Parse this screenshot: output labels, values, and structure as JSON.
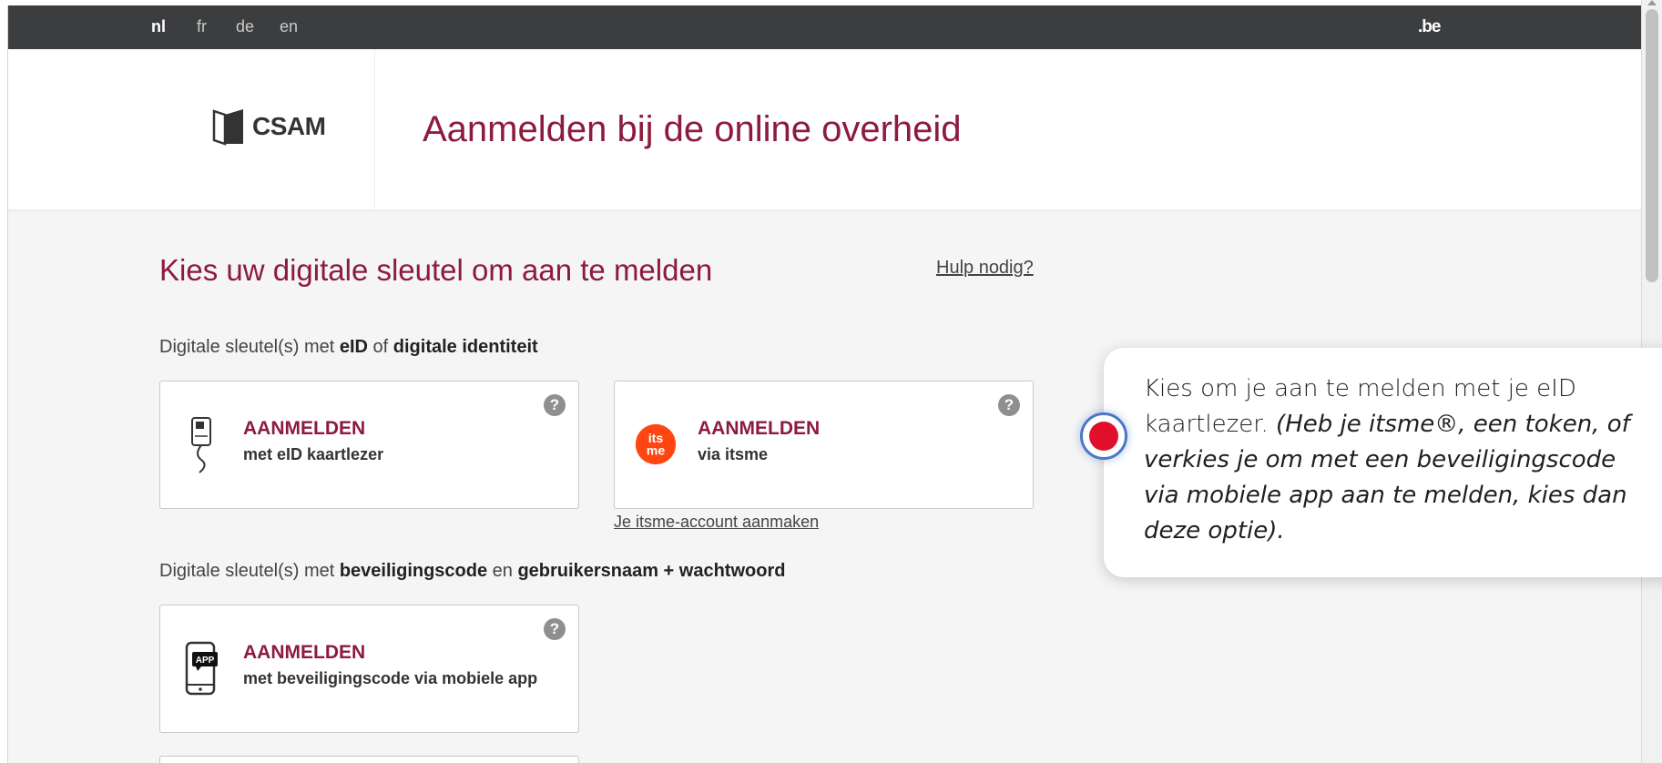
{
  "languages": [
    {
      "code": "nl",
      "active": true
    },
    {
      "code": "fr",
      "active": false
    },
    {
      "code": "de",
      "active": false
    },
    {
      "code": "en",
      "active": false
    }
  ],
  "topbar": {
    "domain": ".be"
  },
  "header": {
    "logo_text": "CSAM",
    "title": "Aanmelden bij de online overheid"
  },
  "main": {
    "title": "Kies uw digitale sleutel om aan te melden",
    "help_link": "Hulp nodig?",
    "section1": {
      "prefix": "Digitale sleutel(s) met ",
      "bold1": "eID",
      "middle": " of ",
      "bold2": "digitale identiteit"
    },
    "section2": {
      "prefix": "Digitale sleutel(s) met ",
      "bold1": "beveiligingscode",
      "middle": " en ",
      "bold2": "gebruikersnaam + wachtwoord"
    },
    "cards": [
      {
        "title": "AANMELDEN",
        "subtitle": "met eID kaartlezer",
        "icon": "card-reader-icon"
      },
      {
        "title": "AANMELDEN",
        "subtitle": "via itsme",
        "icon": "itsme-logo",
        "logo_text_1": "its",
        "logo_text_2": "me"
      },
      {
        "title": "AANMELDEN",
        "subtitle": "met beveiligingscode via mobiele app",
        "icon": "mobile-app-icon",
        "badge": "APP"
      }
    ],
    "help_icon": "?",
    "itsme_link": "Je itsme-account aanmaken"
  },
  "tooltip": {
    "text_normal": "Kies om je aan te melden met je eID kaartlezer. ",
    "text_italic": "(Heb je itsme®, een token, of verkies je om met een beveiligingscode via mobiele app aan te melden, kies dan deze optie)."
  },
  "colors": {
    "brand": "#8c1b3d",
    "topbar": "#3c3d3f",
    "itsme": "#ff4612",
    "hotspot": "#e0102c",
    "hotspot_ring": "#4a78c7"
  }
}
